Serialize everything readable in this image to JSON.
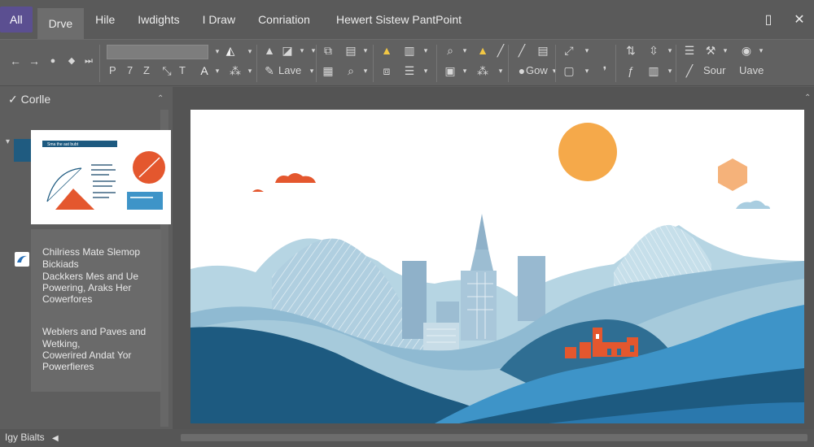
{
  "tabs": [
    {
      "label": "All",
      "state": "purple"
    },
    {
      "label": "Drve",
      "state": "grey"
    },
    {
      "label": "Hile",
      "state": "normal"
    },
    {
      "label": "Iwdights",
      "state": "normal"
    },
    {
      "label": "I Draw",
      "state": "normal"
    },
    {
      "label": "Conriation",
      "state": "normal"
    }
  ],
  "document_title": "Hewert Sistew PantPoint",
  "window_controls": {
    "restore_icon": "restore-icon",
    "close_icon": "close-icon",
    "restore_glyph": "▯",
    "close_glyph": "✕"
  },
  "ribbon": {
    "nav": {
      "back": "←",
      "forward": "→",
      "dot1": "●",
      "dot2": "◆",
      "skip": "⏭"
    },
    "font_buttons": {
      "p": "P",
      "seven": "7",
      "z": "Z",
      "tee": "T"
    },
    "group2_label": "Lave",
    "group_right_label1": "Gow",
    "label_sour": "Sour",
    "label_uave": "Uave"
  },
  "left_panel": {
    "header": "Corlle",
    "header_glyph": "✓",
    "thumb_title": "Sma the aat bubt",
    "item1_lines": [
      "Chilriess Mate Slemop",
      "Bickiads",
      "Dackkers Mes and Ue",
      "Powering, Araks Her",
      "Cowerfores"
    ],
    "item2_lines": [
      "Weblers and Paves and",
      "Wetking,",
      "Cowerired Andat Yor",
      "Powerfieres"
    ]
  },
  "status_bar": {
    "text": "Igy Bialts",
    "arrow": "◀"
  },
  "colors": {
    "accent_purple": "#5b4f91",
    "slide_background": "#ffffff",
    "sun": "#f5a94a",
    "orange_accent": "#e4572e",
    "navy": "#1d5a80",
    "sky_blue": "#3e94c8",
    "pale_blue": "#b6d5e3"
  }
}
